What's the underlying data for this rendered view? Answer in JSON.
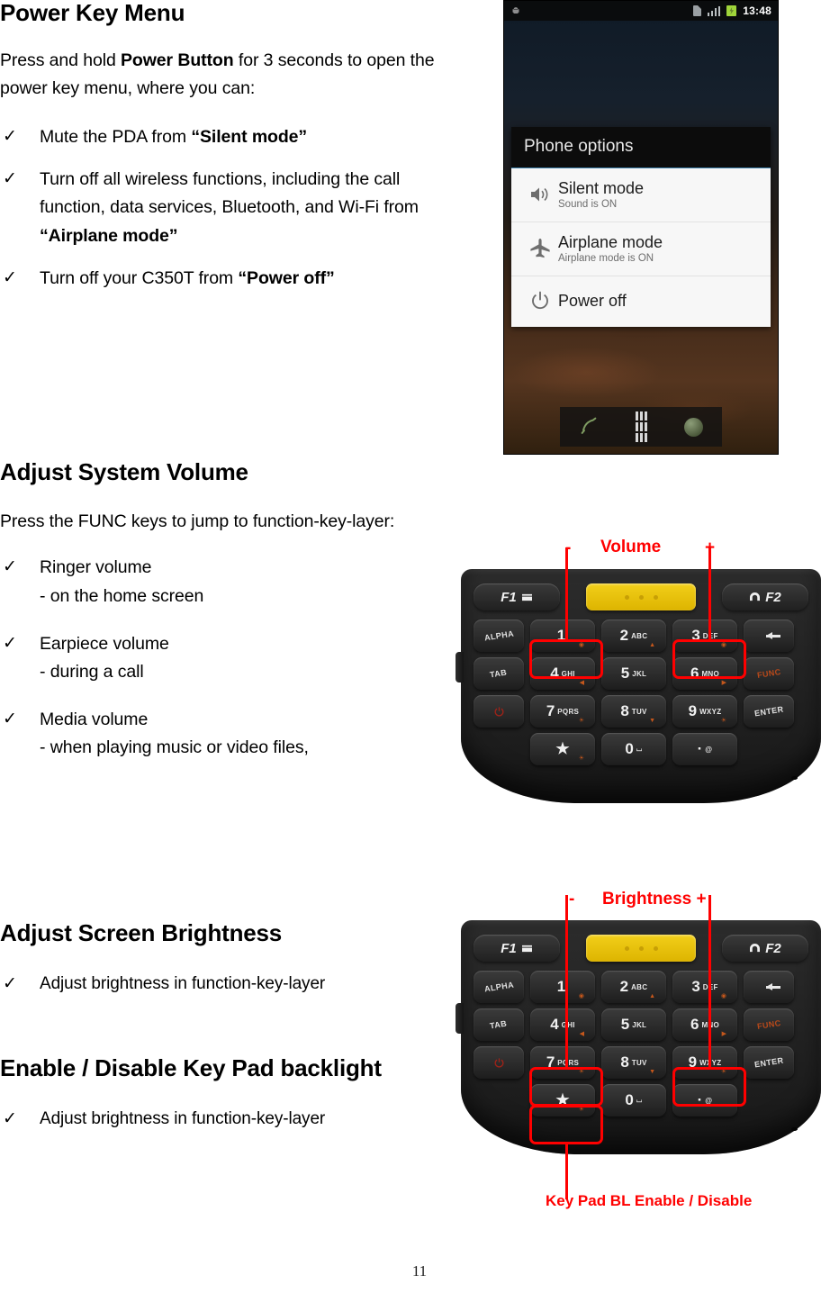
{
  "page": {
    "number": "11"
  },
  "sections": [
    {
      "title": "Power Key Menu",
      "intro_a": "Press and hold ",
      "intro_b": "Power Button",
      "intro_c": " for 3 seconds to open the power key menu, where you can:",
      "bullets": [
        {
          "check": "✓",
          "text_a": "Mute the PDA from ",
          "text_b": "“Silent mode”",
          "text_c": ""
        },
        {
          "check": "✓",
          "text_a": "Turn off all wireless functions, including the call function, data services, Bluetooth, and Wi-Fi from ",
          "text_b": "“Airplane mode”",
          "text_c": ""
        },
        {
          "check": "✓",
          "text_a": "Turn off your C350T from ",
          "text_b": "“Power off”",
          "text_c": ""
        }
      ]
    },
    {
      "title": "Adjust System Volume",
      "intro": "Press the FUNC keys to jump to function-key-layer:",
      "bullets": [
        {
          "check": "✓",
          "line1": "Ringer volume",
          "line2": "- on the home screen"
        },
        {
          "check": "✓",
          "line1": "Earpiece volume",
          "line2": "- during a call"
        },
        {
          "check": "✓",
          "line1": "Media volume",
          "line2": "- when playing music or video files,"
        }
      ]
    },
    {
      "title": "Adjust Screen Brightness",
      "bullets": [
        {
          "check": "✓",
          "text": "Adjust brightness in function-key-layer"
        }
      ]
    },
    {
      "title": "Enable / Disable Key Pad backlight",
      "bullets": [
        {
          "check": "✓",
          "text": "Adjust brightness in function-key-layer"
        }
      ]
    }
  ],
  "phone_screenshot": {
    "statusbar": {
      "droid_icon": "android-robot-icon",
      "sim_icon": "sim-card-icon",
      "signal_icon": "signal-bars-icon",
      "battery_icon": "battery-charging-icon",
      "time": "13:48"
    },
    "dialog": {
      "title": "Phone options",
      "items": [
        {
          "icon": "speaker-icon",
          "label": "Silent mode",
          "sub": "Sound is ON"
        },
        {
          "icon": "airplane-icon",
          "label": "Airplane mode",
          "sub": "Airplane mode is ON"
        },
        {
          "icon": "power-icon",
          "label": "Power off",
          "sub": ""
        }
      ]
    },
    "dock": {
      "phone_icon": "phone-handset-icon",
      "apps_icon": "app-drawer-icon",
      "browser_icon": "browser-orb-icon"
    }
  },
  "keypad": {
    "top_keys": {
      "f1": "F1",
      "scan": "scan-key",
      "f2": "F2"
    },
    "side_left": [
      "ALPHA",
      "TAB",
      "power-key"
    ],
    "side_right": [
      "backspace-key",
      "FUNC",
      "ENTER"
    ],
    "rows": [
      [
        {
          "num": "1",
          "alpha": "",
          "fn": "◉"
        },
        {
          "num": "2",
          "alpha": "ABC",
          "fn": "▲"
        },
        {
          "num": "3",
          "alpha": "DEF",
          "fn": "◉"
        }
      ],
      [
        {
          "num": "4",
          "alpha": "GHI",
          "fn": "◀"
        },
        {
          "num": "5",
          "alpha": "JKL",
          "fn": ""
        },
        {
          "num": "6",
          "alpha": "MNO",
          "fn": "▶"
        }
      ],
      [
        {
          "num": "7",
          "alpha": "PQRS",
          "fn": "☀"
        },
        {
          "num": "8",
          "alpha": "TUV",
          "fn": "▼"
        },
        {
          "num": "9",
          "alpha": "WXYZ",
          "fn": "☀"
        }
      ],
      [
        {
          "num": "★",
          "alpha": "",
          "fn": "☀"
        },
        {
          "num": "0",
          "alpha": "⌴",
          "fn": ""
        },
        {
          "num": "·",
          "alpha": "@",
          "fn": ""
        }
      ]
    ]
  },
  "annotations": {
    "volume": {
      "minus": "-",
      "label": "Volume",
      "plus": "+",
      "color": "#ff0000"
    },
    "brightness": {
      "minus": "-",
      "label": "Brightness +",
      "color": "#ff0000"
    },
    "keypad_backlight": {
      "label": "Key Pad BL Enable / Disable",
      "color": "#ff0000"
    }
  }
}
